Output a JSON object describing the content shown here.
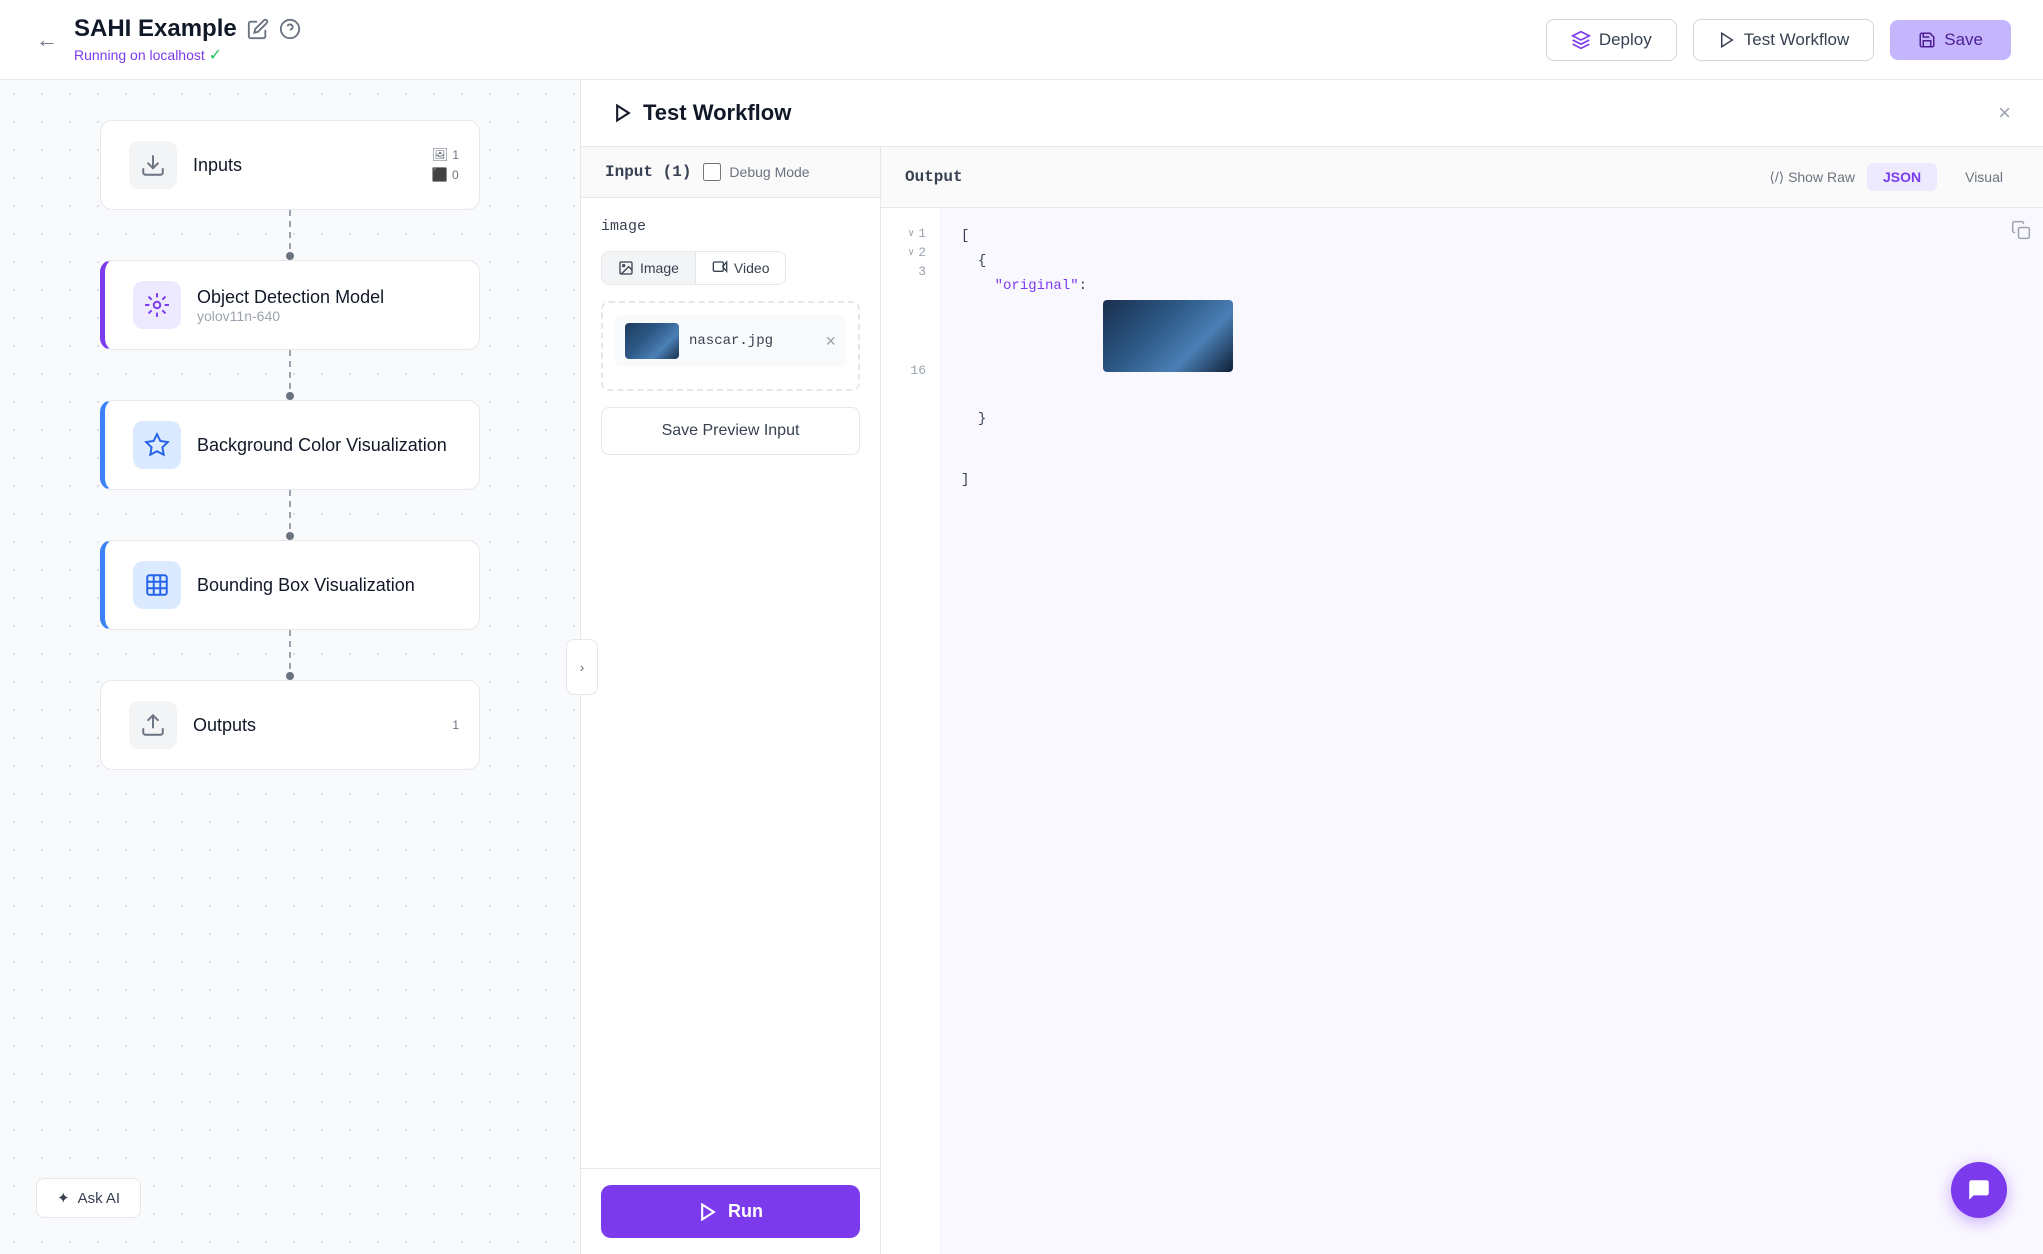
{
  "header": {
    "back_label": "←",
    "app_title": "SAHI Example",
    "running_on_label": "Running on",
    "host": "localhost",
    "deploy_label": "Deploy",
    "test_workflow_label": "Test Workflow",
    "save_label": "Save"
  },
  "canvas": {
    "collapse_icon": "›",
    "nodes": [
      {
        "id": "inputs",
        "title": "Inputs",
        "subtitle": "",
        "type": "inputs",
        "badges": [
          {
            "icon": "🖼",
            "count": "1"
          },
          {
            "icon": "⬛",
            "count": "0"
          }
        ]
      },
      {
        "id": "object-detection",
        "title": "Object Detection Model",
        "subtitle": "yolov11n-640",
        "type": "model",
        "style": "active-purple"
      },
      {
        "id": "bg-color-viz",
        "title": "Background Color Visualization",
        "subtitle": "",
        "type": "viz",
        "style": "active-blue"
      },
      {
        "id": "bbox-viz",
        "title": "Bounding Box Visualization",
        "subtitle": "",
        "type": "bbox",
        "style": "active-blue"
      },
      {
        "id": "outputs",
        "title": "Outputs",
        "subtitle": "",
        "type": "outputs",
        "badges": [
          {
            "icon": "",
            "count": "1"
          }
        ]
      }
    ],
    "ask_ai_label": "✦ Ask AI"
  },
  "test_panel": {
    "title": "Test Workflow",
    "close_icon": "×",
    "input_header": "Input (1)",
    "debug_mode_label": "Debug Mode",
    "output_header": "Output",
    "show_raw_label": "⟨/⟩ Show Raw",
    "tab_json": "JSON",
    "tab_visual": "Visual",
    "input_label": "image",
    "tab_image_label": "Image",
    "tab_video_label": "Video",
    "file_name": "nascar.jpg",
    "save_preview_label": "Save Preview Input",
    "run_label": "Run",
    "json_lines": [
      {
        "num": "1",
        "arrow": "∨",
        "text": "["
      },
      {
        "num": "2",
        "arrow": "∨",
        "text": "  {"
      },
      {
        "num": "3",
        "arrow": "",
        "text": "    \"original\":"
      },
      {
        "num": "...",
        "arrow": "",
        "text": ""
      },
      {
        "num": "16",
        "arrow": "",
        "text": "]"
      }
    ]
  }
}
